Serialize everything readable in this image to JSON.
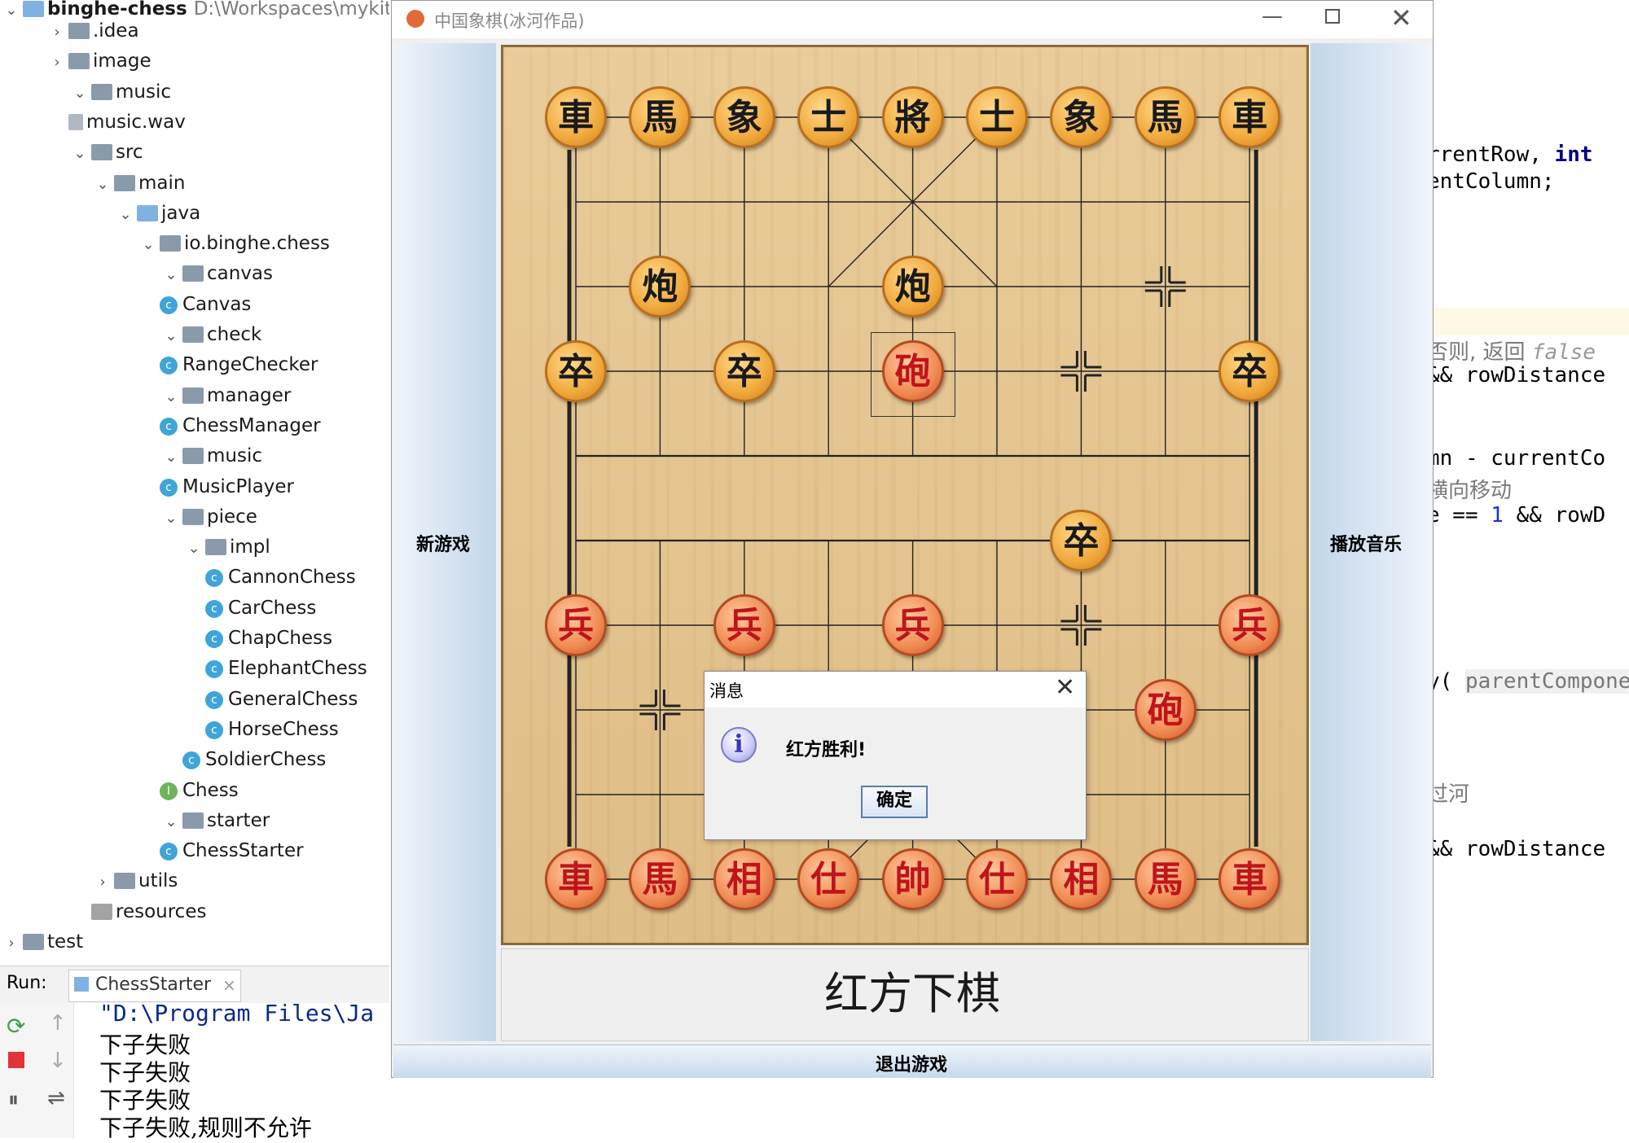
{
  "project_tree": {
    "root": {
      "name": "binghe-chess",
      "path": "D:\\Workspaces\\mykit\\ch"
    },
    "items": [
      {
        "label": ".idea",
        "kind": "folder",
        "expanded": false
      },
      {
        "label": "image",
        "kind": "folder",
        "expanded": false
      },
      {
        "label": "music",
        "kind": "folder",
        "expanded": true
      },
      {
        "label": "music.wav",
        "kind": "file"
      },
      {
        "label": "src",
        "kind": "folder",
        "expanded": true
      },
      {
        "label": "main",
        "kind": "folder",
        "expanded": true
      },
      {
        "label": "java",
        "kind": "folder",
        "expanded": true
      },
      {
        "label": "io.binghe.chess",
        "kind": "package",
        "expanded": true
      },
      {
        "label": "canvas",
        "kind": "package",
        "expanded": true
      },
      {
        "label": "Canvas",
        "kind": "class"
      },
      {
        "label": "check",
        "kind": "package",
        "expanded": true
      },
      {
        "label": "RangeChecker",
        "kind": "class"
      },
      {
        "label": "manager",
        "kind": "package",
        "expanded": true
      },
      {
        "label": "ChessManager",
        "kind": "class"
      },
      {
        "label": "music",
        "kind": "package",
        "expanded": true
      },
      {
        "label": "MusicPlayer",
        "kind": "class"
      },
      {
        "label": "piece",
        "kind": "package",
        "expanded": true
      },
      {
        "label": "impl",
        "kind": "package",
        "expanded": true
      },
      {
        "label": "CannonChess",
        "kind": "class"
      },
      {
        "label": "CarChess",
        "kind": "class"
      },
      {
        "label": "ChapChess",
        "kind": "class"
      },
      {
        "label": "ElephantChess",
        "kind": "class"
      },
      {
        "label": "GeneralChess",
        "kind": "class"
      },
      {
        "label": "HorseChess",
        "kind": "class"
      },
      {
        "label": "SoldierChess",
        "kind": "class"
      },
      {
        "label": "Chess",
        "kind": "interface"
      },
      {
        "label": "starter",
        "kind": "package",
        "expanded": true
      },
      {
        "label": "ChessStarter",
        "kind": "class"
      },
      {
        "label": "utils",
        "kind": "package",
        "expanded": false
      },
      {
        "label": "resources",
        "kind": "folder"
      },
      {
        "label": "test",
        "kind": "folder",
        "expanded": false
      }
    ]
  },
  "run_panel": {
    "label": "Run:",
    "tab": "ChessStarter",
    "console": [
      "\"D:\\Program Files\\Ja",
      "下子失败",
      "下子失败",
      "下子失败",
      "下子失败,规则不允许"
    ]
  },
  "code_snippets": [
    {
      "text": "rrentRow, ",
      "keyword": "int"
    },
    {
      "text": "entColumn;"
    },
    {
      "text": "否则, 返回 ",
      "italic": "false"
    },
    {
      "text": "&& rowDistance"
    },
    {
      "text": "mn - currentCo"
    },
    {
      "text": "横向移动"
    },
    {
      "text": "e == ",
      "num": "1",
      "rest": " && rowD"
    },
    {
      "text": "y( ",
      "param": "parentCompone"
    },
    {
      "text": "过河"
    },
    {
      "text": "&& rowDistance"
    }
  ],
  "window": {
    "title": "中国象棋(冰河作品)",
    "buttons": {
      "new_game": "新游戏",
      "play_music": "播放音乐",
      "exit_game": "退出游戏"
    },
    "status": "红方下棋"
  },
  "pieces": [
    {
      "side": "black",
      "char": "車",
      "col": 0,
      "row": 0
    },
    {
      "side": "black",
      "char": "馬",
      "col": 1,
      "row": 0
    },
    {
      "side": "black",
      "char": "象",
      "col": 2,
      "row": 0
    },
    {
      "side": "black",
      "char": "士",
      "col": 3,
      "row": 0
    },
    {
      "side": "black",
      "char": "將",
      "col": 4,
      "row": 0
    },
    {
      "side": "black",
      "char": "士",
      "col": 5,
      "row": 0
    },
    {
      "side": "black",
      "char": "象",
      "col": 6,
      "row": 0
    },
    {
      "side": "black",
      "char": "馬",
      "col": 7,
      "row": 0
    },
    {
      "side": "black",
      "char": "車",
      "col": 8,
      "row": 0
    },
    {
      "side": "black",
      "char": "炮",
      "col": 1,
      "row": 2
    },
    {
      "side": "black",
      "char": "炮",
      "col": 4,
      "row": 2
    },
    {
      "side": "black",
      "char": "卒",
      "col": 0,
      "row": 3
    },
    {
      "side": "black",
      "char": "卒",
      "col": 2,
      "row": 3
    },
    {
      "side": "black",
      "char": "卒",
      "col": 8,
      "row": 3
    },
    {
      "side": "red",
      "char": "砲",
      "col": 4,
      "row": 3,
      "selected": true
    },
    {
      "side": "black",
      "char": "卒",
      "col": 6,
      "row": 5
    },
    {
      "side": "red",
      "char": "兵",
      "col": 0,
      "row": 6
    },
    {
      "side": "red",
      "char": "兵",
      "col": 2,
      "row": 6
    },
    {
      "side": "red",
      "char": "兵",
      "col": 4,
      "row": 6
    },
    {
      "side": "red",
      "char": "兵",
      "col": 8,
      "row": 6
    },
    {
      "side": "red",
      "char": "砲",
      "col": 7,
      "row": 7
    },
    {
      "side": "red",
      "char": "車",
      "col": 0,
      "row": 9
    },
    {
      "side": "red",
      "char": "馬",
      "col": 1,
      "row": 9
    },
    {
      "side": "red",
      "char": "相",
      "col": 2,
      "row": 9
    },
    {
      "side": "red",
      "char": "仕",
      "col": 3,
      "row": 9
    },
    {
      "side": "red",
      "char": "帥",
      "col": 4,
      "row": 9
    },
    {
      "side": "red",
      "char": "仕",
      "col": 5,
      "row": 9
    },
    {
      "side": "red",
      "char": "相",
      "col": 6,
      "row": 9
    },
    {
      "side": "red",
      "char": "馬",
      "col": 7,
      "row": 9
    },
    {
      "side": "red",
      "char": "車",
      "col": 8,
      "row": 9
    }
  ],
  "markers": [
    {
      "col": 7,
      "row": 2
    },
    {
      "col": 6,
      "row": 3
    },
    {
      "col": 6,
      "row": 6
    },
    {
      "col": 1,
      "row": 7
    }
  ],
  "dialog": {
    "title": "消息",
    "message": "红方胜利!",
    "ok": "确定"
  },
  "colors": {
    "accent": "#3fa4d8",
    "board": "#e4c48f",
    "red_piece": "#c0141a",
    "sidebar": "#c3d6ea"
  }
}
